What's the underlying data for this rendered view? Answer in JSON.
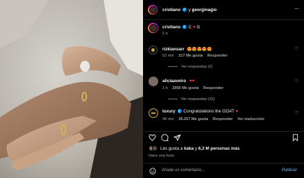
{
  "post": {
    "author": "cristiano",
    "connector": "y",
    "coauthor": "georginagio",
    "caption_author": "cristiano",
    "caption_text": "C",
    "caption_heart": "♥",
    "caption_end": "G",
    "caption_time": "1 h"
  },
  "comments": [
    {
      "user": "rizkiansarr",
      "text": "😍😍😍😍😍",
      "time": "52 min",
      "likes": "217 Me gusta",
      "reply_label": "Responder",
      "view_replies": "Ver respuestas (2)"
    },
    {
      "user": "aliciaaveiro",
      "text": "♥♥",
      "time": "1 h",
      "likes": "2950 Me gusta",
      "reply_label": "Responder",
      "view_replies": "Ver respuestas (15)"
    },
    {
      "user": "luxury",
      "text": "Congratulations the GOAT",
      "text_heart": "♥",
      "time": "49 min",
      "likes": "35.257 Me gusta",
      "reply_label": "Responder",
      "translate_label": "Ver traducción"
    }
  ],
  "likes_summary": {
    "prefix": "Les gusta a",
    "user": "kaka",
    "middle": "y",
    "count": "6,3 M personas más"
  },
  "posted_ago": "Hace una hora",
  "comment_box": {
    "placeholder": "Añade un comentario...",
    "publish": "Publicar"
  },
  "colors": {
    "background": "#000000",
    "muted_text": "#a8a8a8",
    "verified": "#0095f6",
    "heart": "#ff3040",
    "divider": "#262626"
  },
  "icons": [
    "more-icon",
    "verified-icon",
    "heart-icon",
    "comment-icon",
    "share-icon",
    "save-icon",
    "emoji-icon"
  ]
}
